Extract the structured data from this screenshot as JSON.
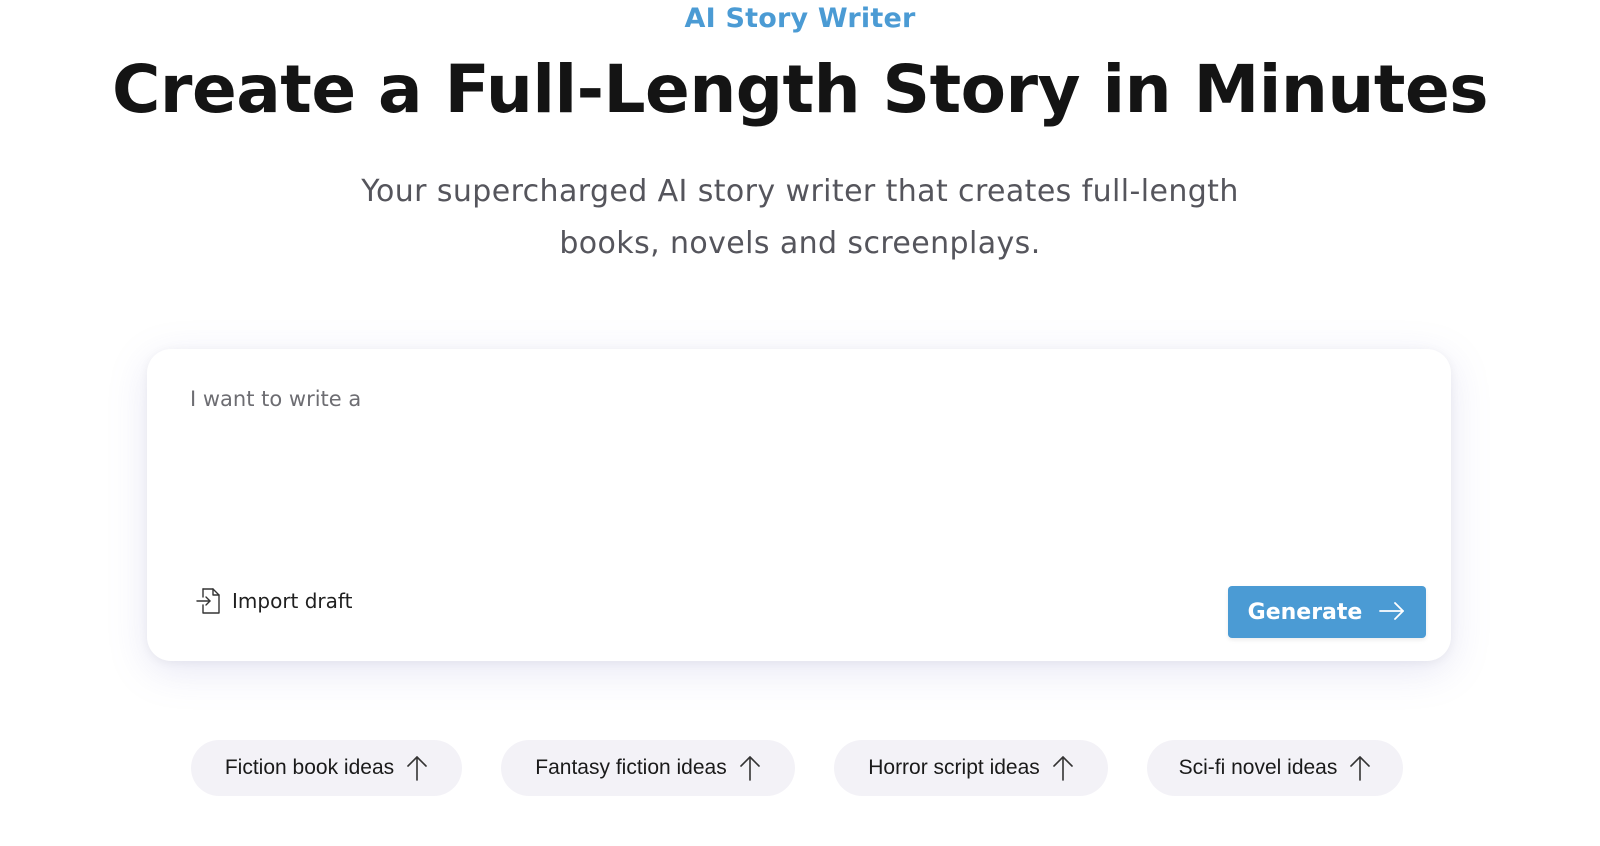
{
  "header": {
    "eyebrow": "AI Story Writer",
    "title": "Create a Full-Length Story in Minutes",
    "subtitle_line1": "Your supercharged AI story writer that creates full-length",
    "subtitle_line2": "books, novels and screenplays."
  },
  "composer": {
    "placeholder": "I want to write a",
    "value": "",
    "import_label": "Import draft",
    "import_icon": "import-file-icon",
    "generate_label": "Generate",
    "generate_icon": "arrow-right-icon"
  },
  "idea_chips": [
    {
      "label": "Fiction book ideas",
      "icon": "arrow-up-icon"
    },
    {
      "label": "Fantasy fiction ideas",
      "icon": "arrow-up-icon"
    },
    {
      "label": "Horror script ideas",
      "icon": "arrow-up-icon"
    },
    {
      "label": "Sci-fi novel ideas",
      "icon": "arrow-up-icon"
    }
  ],
  "colors": {
    "accent": "#4b9bd4",
    "heading": "#141414",
    "subtitle": "#55555c",
    "chip_bg": "#f3f2f7"
  }
}
